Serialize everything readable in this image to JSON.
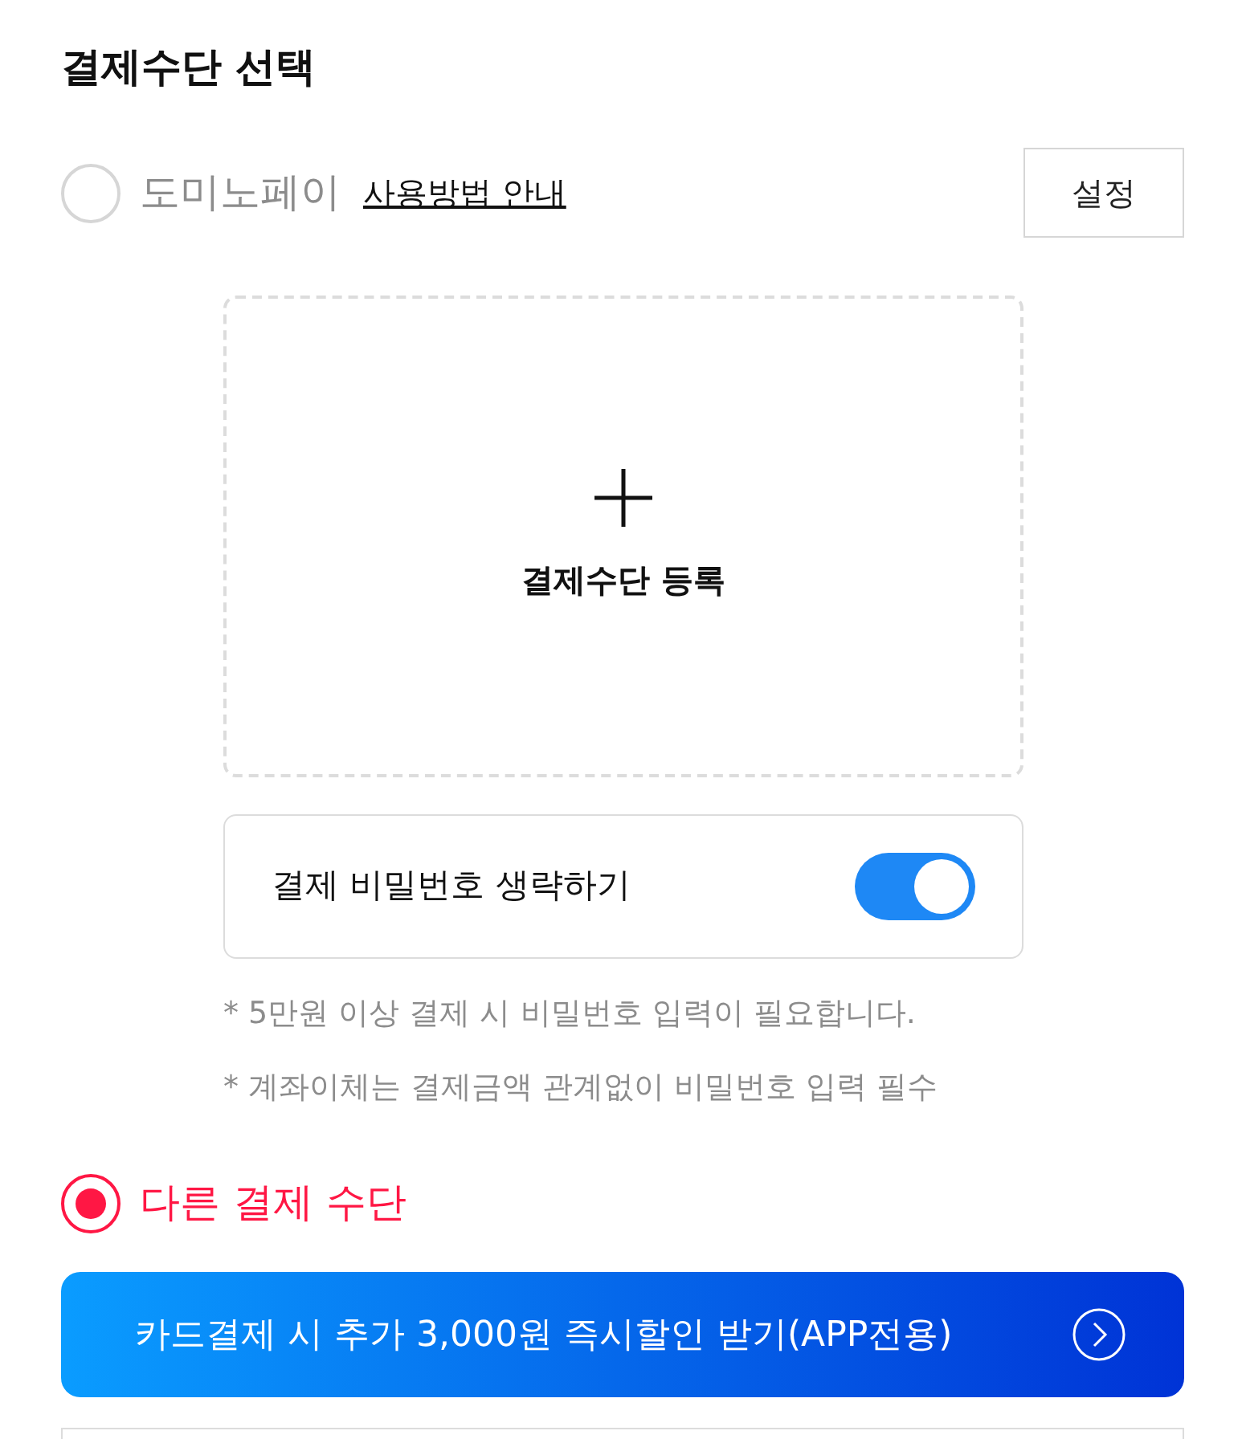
{
  "title": "결제수단 선택",
  "options": [
    {
      "label": "도미노페이",
      "selected": false,
      "guide_link": "사용방법 안내",
      "settings_button": "설정",
      "register": "결제수단 등록",
      "skip_password": {
        "label": "결제 비밀번호 생략하기",
        "on": true
      },
      "notes": [
        "* 5만원 이상 결제 시 비밀번호 입력이 필요합니다.",
        "* 계좌이체는 결제금액 관계없이 비밀번호 입력 필수"
      ]
    },
    {
      "label": "다른 결제 수단",
      "selected": true,
      "banner": "카드결제 시 추가 3,000원 즉시할인 받기(APP전용)"
    }
  ]
}
